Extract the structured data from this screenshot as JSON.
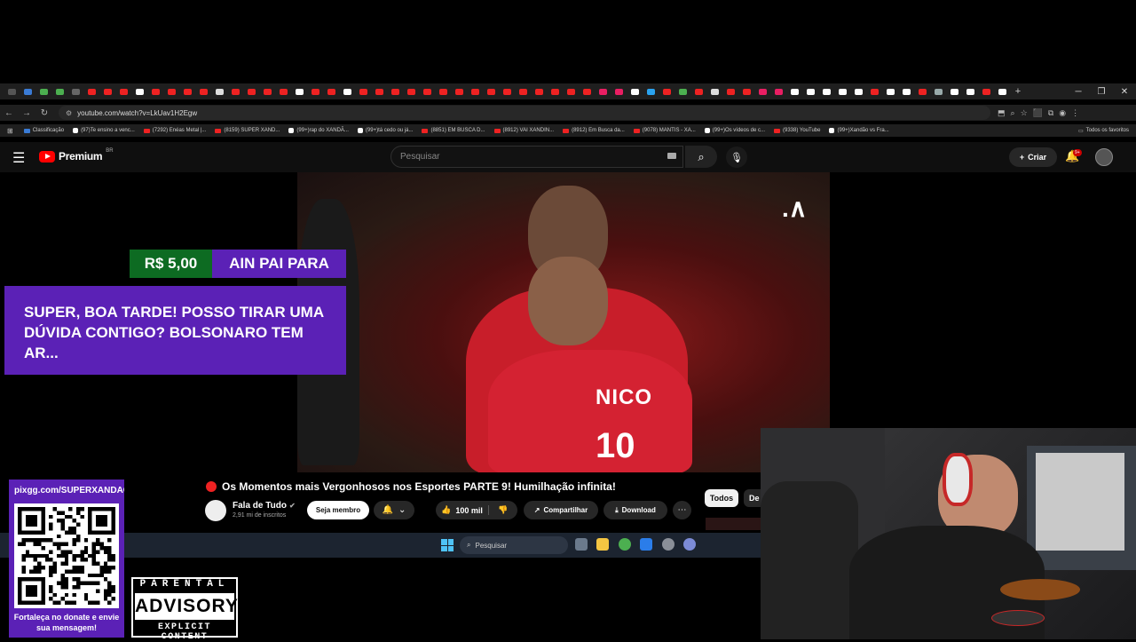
{
  "browser": {
    "url": "youtube.com/watch?v=LkUav1H2Egw",
    "bookmarks": [
      {
        "label": "Classificação",
        "icon": "globe-icon",
        "color": "#3a7bd5"
      },
      {
        "label": "(97)Te ensino a venc...",
        "icon": "tiktok-icon",
        "color": "#ffffff"
      },
      {
        "label": "(7292) Enéas Metal |...",
        "icon": "youtube-icon",
        "color": "#ee2222"
      },
      {
        "label": "(8159) SUPER XAND...",
        "icon": "youtube-icon",
        "color": "#ee2222"
      },
      {
        "label": "(99+)rap do XANDÃ...",
        "icon": "tiktok-icon",
        "color": "#ffffff"
      },
      {
        "label": "(99+)tá cedo ou já...",
        "icon": "tiktok-icon",
        "color": "#ffffff"
      },
      {
        "label": "(8851) EM BUSCA D...",
        "icon": "youtube-icon",
        "color": "#ee2222"
      },
      {
        "label": "(8912) VAI XANDIN...",
        "icon": "youtube-icon",
        "color": "#ee2222"
      },
      {
        "label": "(8912) Em Busca da...",
        "icon": "youtube-icon",
        "color": "#ee2222"
      },
      {
        "label": "(9078) MANTIS - XA...",
        "icon": "youtube-icon",
        "color": "#ee2222"
      },
      {
        "label": "(99+)Os vídeos de c...",
        "icon": "tiktok-icon",
        "color": "#ffffff"
      },
      {
        "label": "(9338) YouTube",
        "icon": "youtube-icon",
        "color": "#ee2222"
      },
      {
        "label": "(99+)Xandão vs Fra...",
        "icon": "tiktok-icon",
        "color": "#ffffff"
      }
    ],
    "all_favorites": "Todos os favoritos"
  },
  "youtube": {
    "logo_text": "Premium",
    "logo_region": "BR",
    "search_placeholder": "Pesquisar",
    "create_label": "Criar",
    "notifications_badge": "9+"
  },
  "video_overlay": {
    "jersey_name": "NICO",
    "jersey_number": "10"
  },
  "donation": {
    "amount": "R$ 5,00",
    "donor": "AIN PAI PARA",
    "message": "SUPER, BOA TARDE! POSSO TIRAR UMA DÚVIDA CONTIGO? BOLSONARO TEM AR..."
  },
  "video_info": {
    "title": "Os Momentos mais Vergonhosos nos Esportes PARTE 9! Humilhação infinita!",
    "channel": "Fala de Tudo",
    "subscribers": "2,91 mi de inscritos",
    "join_label": "Seja membro",
    "likes": "100 mil",
    "share_label": "Compartilhar",
    "download_label": "Download",
    "chips": [
      "Todos",
      "De"
    ]
  },
  "taskbar": {
    "search_placeholder": "Pesquisar"
  },
  "qr_panel": {
    "url": "pixgg.com/SUPERXANDAO",
    "caption": "Fortaleça no donate e envie sua mensagem!"
  },
  "parental_advisory": {
    "top": "PARENTAL",
    "middle": "ADVISORY",
    "bottom": "EXPLICIT CONTENT"
  }
}
